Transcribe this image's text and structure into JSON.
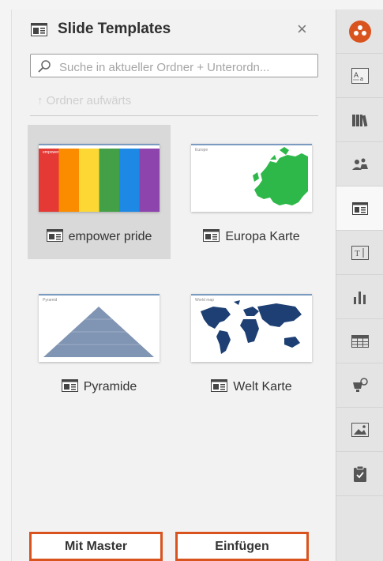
{
  "panel": {
    "title": "Slide Templates",
    "close_label": "×",
    "search_placeholder": "Suche in aktueller Ordner + Unterordn...",
    "up_label": "↑  Ordner aufwärts"
  },
  "templates": [
    {
      "label": "empower pride",
      "selected": true,
      "thumb_text": "empower"
    },
    {
      "label": "Europa Karte",
      "selected": false,
      "thumb_text": "Europe"
    },
    {
      "label": "Pyramide",
      "selected": false,
      "thumb_text": "Pyramid"
    },
    {
      "label": "Welt Karte",
      "selected": false,
      "thumb_text": "World map"
    }
  ],
  "buttons": {
    "master": "Mit Master",
    "insert": "Einfügen"
  },
  "colors": {
    "accent_orange": "#d9531e",
    "pride": [
      "#e53935",
      "#fb8c00",
      "#fdd835",
      "#43a047",
      "#1e88e5",
      "#8e44ad"
    ],
    "map_green": "#2fb84a",
    "map_blue": "#1d3f73",
    "pyramid": "#8094b3"
  },
  "rail": [
    "app-logo-icon",
    "text-style-icon",
    "library-icon",
    "people-icon",
    "slide-template-icon",
    "textbox-icon",
    "chart-icon",
    "table-icon",
    "ideas-icon",
    "picture-icon",
    "clipboard-icon"
  ]
}
